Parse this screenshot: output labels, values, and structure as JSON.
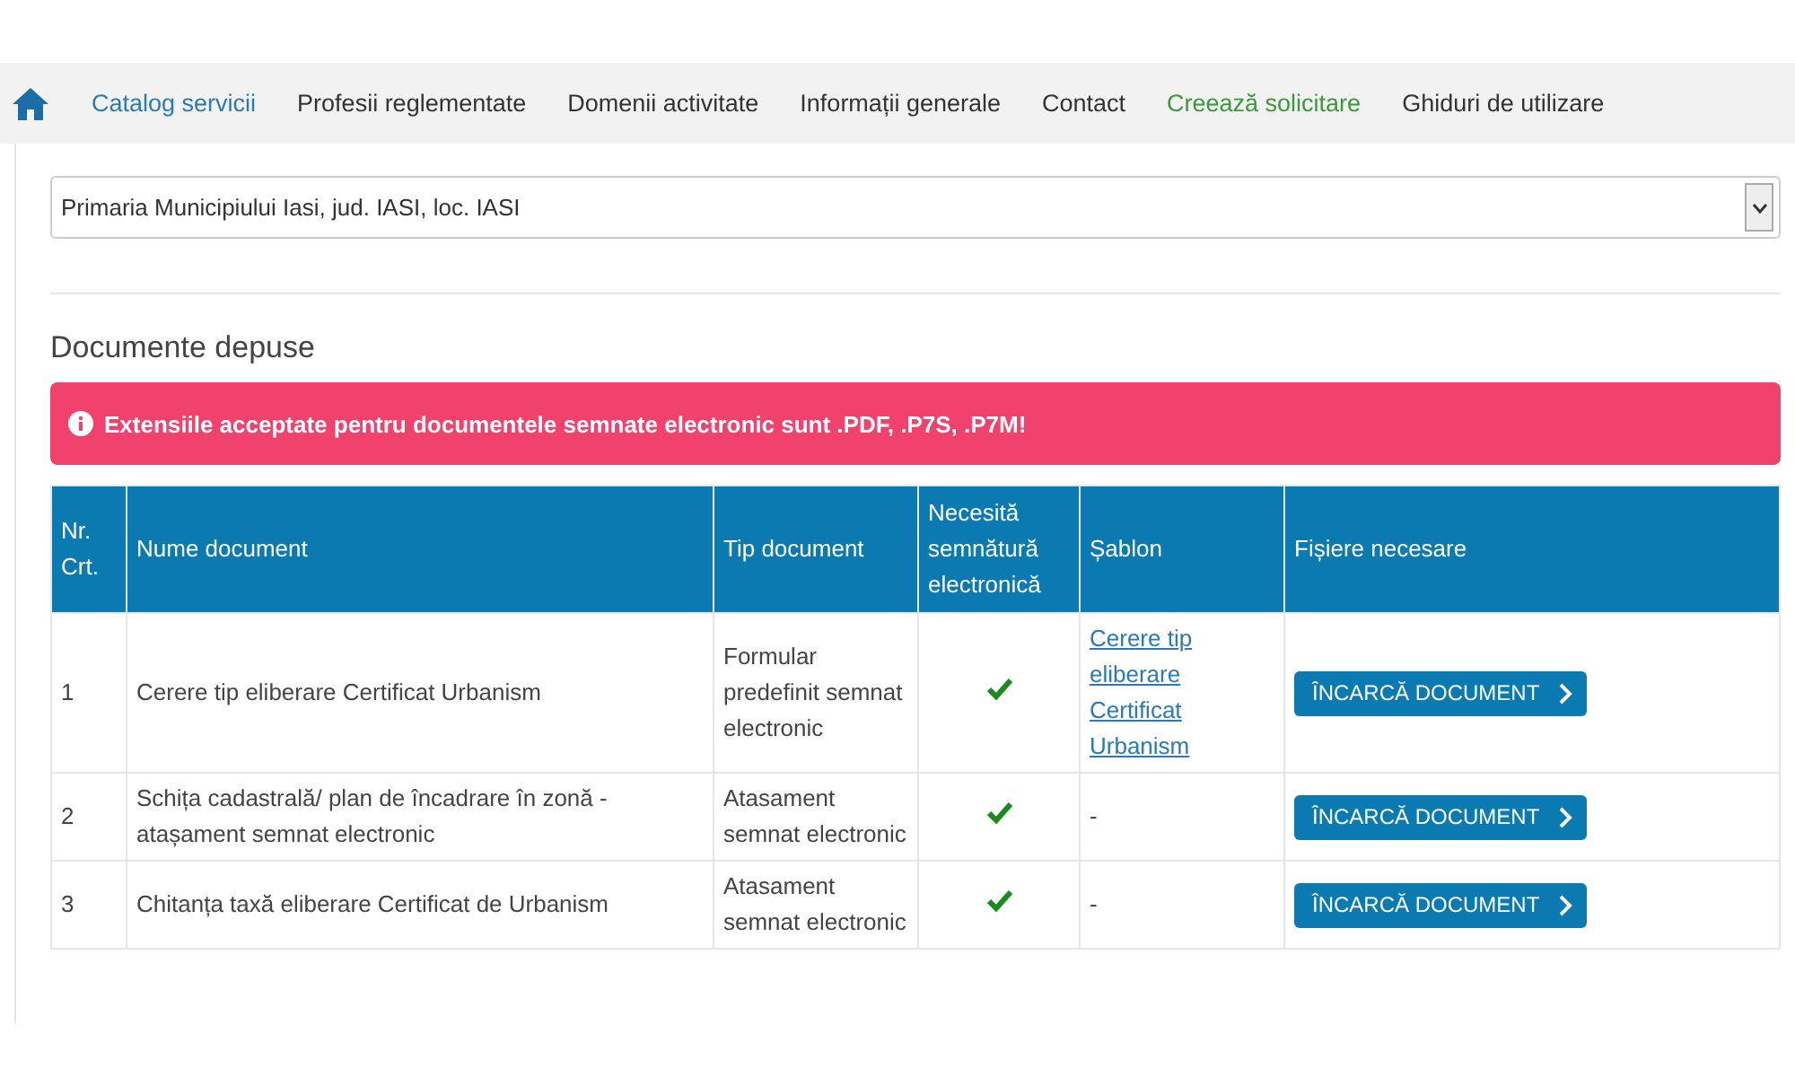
{
  "nav": {
    "items": [
      {
        "label": "Catalog servicii",
        "color": "#2a7ab8"
      },
      {
        "label": "Profesii reglementate",
        "color": "#333333"
      },
      {
        "label": "Domenii activitate",
        "color": "#333333"
      },
      {
        "label": "Informații generale",
        "color": "#333333"
      },
      {
        "label": "Contact",
        "color": "#333333"
      },
      {
        "label": "Creează solicitare",
        "color": "#3a9a3a"
      },
      {
        "label": "Ghiduri de utilizare",
        "color": "#333333"
      }
    ]
  },
  "institution_select": {
    "value": "Primaria Municipiului Iasi, jud. IASI, loc. IASI"
  },
  "section_title": "Documente depuse",
  "alert": "Extensiile acceptate pentru documentele semnate electronic sunt .PDF, .P7S, .P7M!",
  "table": {
    "columns": [
      "Nr. Crt.",
      "Nume document",
      "Tip document",
      "Necesită semnătură electronică",
      "Șablon",
      "Fișiere necesare"
    ],
    "rows": [
      {
        "nr": "1",
        "name": "Cerere tip eliberare Certificat Urbanism",
        "type": "Formular predefinit semnat electronic",
        "signature_required": true,
        "template": {
          "kind": "link",
          "text": "Cerere tip eliberare Certificat Urbanism"
        },
        "button": "ÎNCARCĂ DOCUMENT"
      },
      {
        "nr": "2",
        "name": "Schița cadastrală/ plan de încadrare în zonă - atașament semnat electronic",
        "type": "Atasament semnat electronic",
        "signature_required": true,
        "template": {
          "kind": "text",
          "text": "-"
        },
        "button": "ÎNCARCĂ DOCUMENT"
      },
      {
        "nr": "3",
        "name": "Chitanța taxă eliberare Certificat de Urbanism",
        "type": "Atasament semnat electronic",
        "signature_required": true,
        "template": {
          "kind": "text",
          "text": "-"
        },
        "button": "ÎNCARCĂ DOCUMENT"
      }
    ]
  }
}
